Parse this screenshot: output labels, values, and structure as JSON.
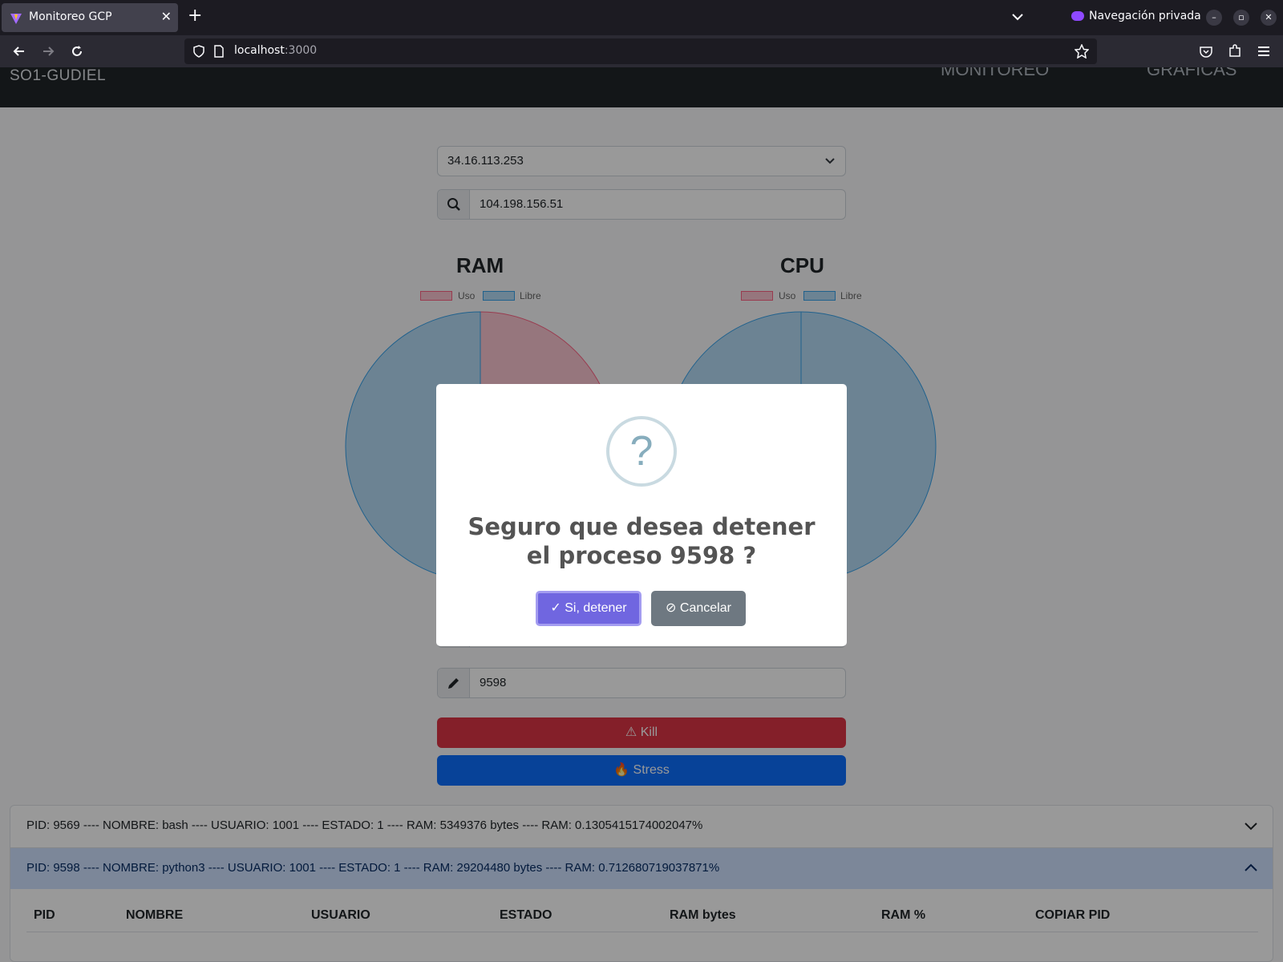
{
  "browser": {
    "tab_title": "Monitoreo GCP",
    "tab_close": "✕",
    "new_tab": "+",
    "private_label": "Navegación privada",
    "url_host": "localhost",
    "url_port": ":3000"
  },
  "app": {
    "brand": "SO1-GUDIEL",
    "nav": [
      "MONITOREO",
      "GRAFICAS"
    ],
    "select_value": "34.16.113.253",
    "search_value": "104.198.156.51",
    "pid_input_value": "9598",
    "kill_label": "Kill",
    "stress_label": "Stress"
  },
  "charts": {
    "ram_title": "RAM",
    "cpu_title": "CPU",
    "legend_uso": "Uso",
    "legend_libre": "Libre",
    "uso_color": "#ff6384",
    "libre_color": "#36a2eb"
  },
  "chart_data": [
    {
      "type": "pie",
      "title": "RAM",
      "categories": [
        "Uso",
        "Libre"
      ],
      "values": [
        29,
        71
      ]
    },
    {
      "type": "pie",
      "title": "CPU",
      "categories": [
        "Uso",
        "Libre"
      ],
      "values": [
        0,
        100
      ]
    }
  ],
  "processes": [
    "PID: 9569 ---- NOMBRE: bash ---- USUARIO: 1001 ---- ESTADO: 1 ---- RAM: 5349376 bytes ---- RAM: 0.1305415174002047%",
    "PID: 9598 ---- NOMBRE: python3 ---- USUARIO: 1001 ---- ESTADO: 1 ---- RAM: 29204480 bytes ---- RAM: 0.712680719037871%"
  ],
  "table_headers": [
    "PID",
    "NOMBRE",
    "USUARIO",
    "ESTADO",
    "RAM bytes",
    "RAM %",
    "COPIAR PID"
  ],
  "modal": {
    "icon": "?",
    "title": "Seguro que desea detener el proceso 9598 ?",
    "confirm_label": "Si, detener",
    "cancel_label": "Cancelar"
  }
}
